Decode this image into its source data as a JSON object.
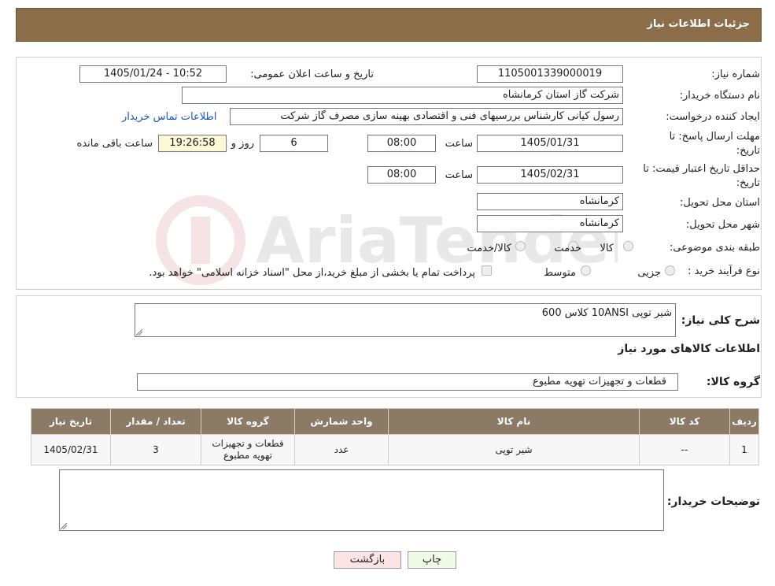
{
  "header": {
    "title": "جزئیات اطلاعات نیاز"
  },
  "fields": {
    "need_number_label": "شماره نیاز:",
    "need_number": "1105001339000019",
    "announce_label": "تاریخ و ساعت اعلان عمومی:",
    "announce_value": "1405/01/24 - 10:52",
    "buyer_label": "نام دستگاه خریدار:",
    "buyer": "شرکت گاز استان کرمانشاه",
    "creator_label": "ایجاد کننده درخواست:",
    "creator": "رسول کیانی کارشناس بررسیهای فنی و اقتصادی بهینه سازی مصرف گاز شرکت",
    "contact_link": "اطلاعات تماس خریدار",
    "deadline_label": "مهلت ارسال پاسخ: تا تاریخ:",
    "deadline_date": "1405/01/31",
    "time_label": "ساعت",
    "deadline_time": "08:00",
    "days": "6",
    "days_label": "روز و",
    "remaining_time": "19:26:58",
    "remaining_label": "ساعت باقی مانده",
    "validity_label": "حداقل تاریخ اعتبار قیمت: تا تاریخ:",
    "validity_date": "1405/02/31",
    "validity_time": "08:00",
    "province_label": "استان محل تحویل:",
    "province": "کرمانشاه",
    "city_label": "شهر محل تحویل:",
    "city": "کرمانشاه",
    "category_label": "طبقه بندی موضوعی:",
    "category_options": [
      "کالا",
      "خدمت",
      "کالا/خدمت"
    ],
    "process_label": "نوع فرآیند خرید :",
    "process_options": [
      "جزیی",
      "متوسط"
    ],
    "payment_note": "پرداخت تمام یا بخشی از مبلغ خرید،از محل \"اسناد خزانه اسلامی\" خواهد بود."
  },
  "description": {
    "label": "شرح کلی نیاز:",
    "value": "شیر توپی 10ANSI کلاس 600",
    "goods_info_title": "اطلاعات کالاهای مورد نیاز",
    "group_label": "گروه کالا:",
    "group_value": "قطعات و تجهیزات تهویه مطبوع"
  },
  "table": {
    "headers": [
      "ردیف",
      "کد کالا",
      "نام کالا",
      "واحد شمارش",
      "گروه کالا",
      "تعداد / مقدار",
      "تاریخ نیاز"
    ],
    "rows": [
      [
        "1",
        "--",
        "شیر توپی",
        "عدد",
        "قطعات و تجهیزات تهویه مطبوع",
        "3",
        "1405/02/31"
      ]
    ]
  },
  "buyer_notes": {
    "label": "توضیحات خریدار:",
    "value": ""
  },
  "buttons": {
    "print": "چاپ",
    "back": "بازگشت"
  },
  "colors": {
    "header": "#8b6d4a",
    "table_header": "#8b7a66",
    "link": "#1a56b8"
  }
}
